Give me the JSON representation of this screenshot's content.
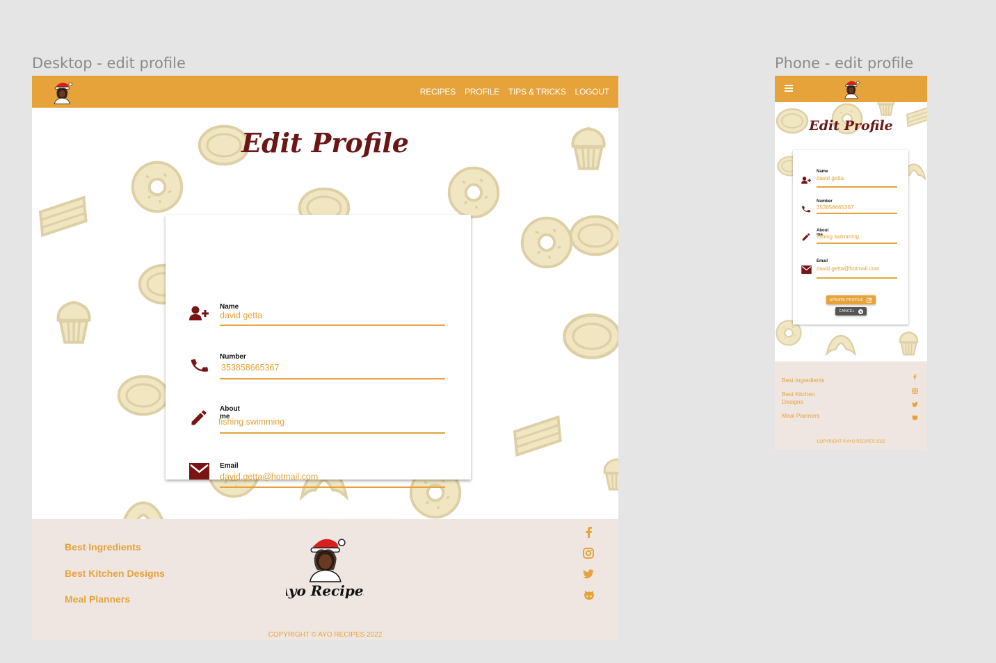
{
  "frames": {
    "desktop_title": "Desktop - edit profile",
    "phone_title": "Phone - edit profile"
  },
  "colors": {
    "accent": "#e6a33a",
    "heading": "#6b1515",
    "icon": "#7a1414",
    "footer_bg": "#efe6e1",
    "cancel_bg": "#555555"
  },
  "nav": {
    "links": [
      "RECIPES",
      "PROFILE",
      "TIPS & TRICKS",
      "LOGOUT"
    ],
    "logo": "chef-logo-icon",
    "menu_icon": "hamburger-menu-icon"
  },
  "page": {
    "heading": "Edit Profile"
  },
  "form": {
    "fields": [
      {
        "label": "Name",
        "value": "david getta",
        "icon": "add-user-icon"
      },
      {
        "label": "Number",
        "value": "353858665367",
        "icon": "phone-icon"
      },
      {
        "label": "About me",
        "value": "fishing swimming",
        "icon": "pencil-icon"
      },
      {
        "label": "Email",
        "value": "david.getta@hotmail.com",
        "icon": "envelope-icon"
      }
    ],
    "update_label": "UPDATE PROFILE",
    "cancel_label": "CANCEL"
  },
  "footer": {
    "links": [
      "Best Ingredients",
      "Best Kitchen Designs",
      "Meal Planners"
    ],
    "social_icons": [
      "facebook-icon",
      "instagram-icon",
      "twitter-icon",
      "github-icon"
    ],
    "logo_text": "Ayo Recipes",
    "copyright": "COPYRIGHT © AYO RECIPES 2022"
  }
}
